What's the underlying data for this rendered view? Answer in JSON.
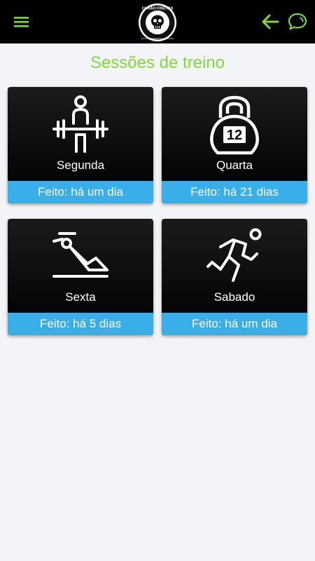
{
  "header": {
    "logo_text_top": "CURÃO FREITAS",
    "logo_text_bottom": "ALTO RENDIMENTO FUNCIONAL",
    "accent_color": "#7fd93a"
  },
  "page": {
    "title": "Sessões de treino"
  },
  "sessions": [
    {
      "day": "Segunda",
      "status": "Feito: há um dia",
      "icon": "weightlifter-icon"
    },
    {
      "day": "Quarta",
      "status": "Feito: há 21 dias",
      "icon": "kettlebell-icon",
      "kettlebell_number": "12"
    },
    {
      "day": "Sexta",
      "status": "Feito: há 5 dias",
      "icon": "situp-icon"
    },
    {
      "day": "Sabado",
      "status": "Feito: há um dia",
      "icon": "runner-icon"
    }
  ]
}
